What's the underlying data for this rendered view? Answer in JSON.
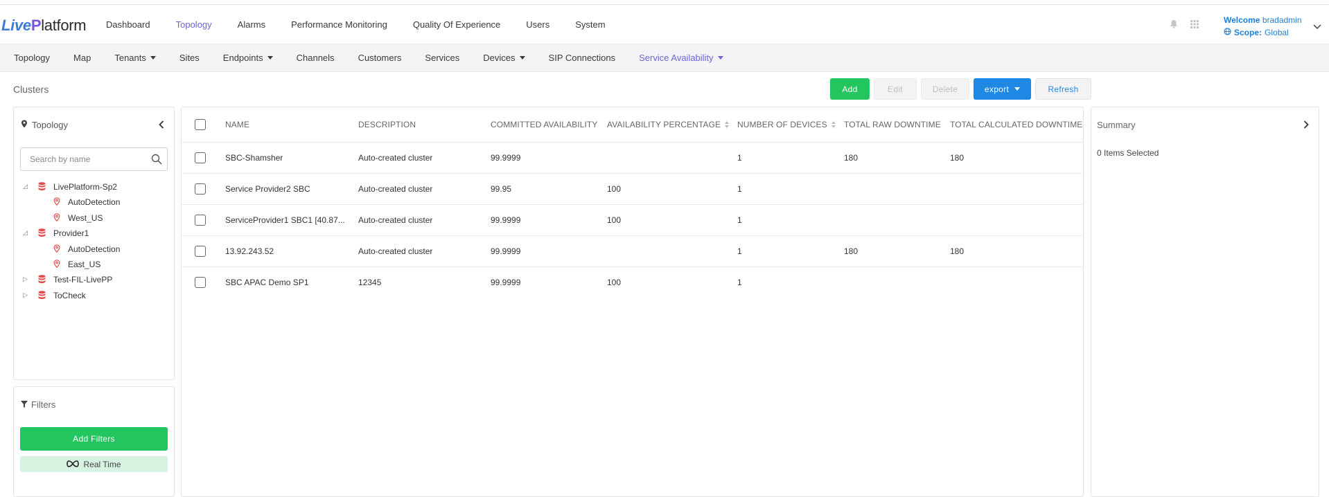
{
  "app": {
    "logo": {
      "part1": "Live",
      "part2": "P",
      "part3": "latform"
    },
    "main_menu": [
      {
        "label": "Dashboard",
        "active": false
      },
      {
        "label": "Topology",
        "active": true
      },
      {
        "label": "Alarms",
        "active": false
      },
      {
        "label": "Performance Monitoring",
        "active": false
      },
      {
        "label": "Quality Of Experience",
        "active": false
      },
      {
        "label": "Users",
        "active": false
      },
      {
        "label": "System",
        "active": false
      }
    ],
    "user": {
      "welcome_label": "Welcome",
      "username": "bradadmin",
      "scope_label": "Scope:",
      "scope_value": "Global"
    }
  },
  "sub_menu": [
    {
      "label": "Topology",
      "dropdown": false,
      "active": false
    },
    {
      "label": "Map",
      "dropdown": false,
      "active": false
    },
    {
      "label": "Tenants",
      "dropdown": true,
      "active": false
    },
    {
      "label": "Sites",
      "dropdown": false,
      "active": false
    },
    {
      "label": "Endpoints",
      "dropdown": true,
      "active": false
    },
    {
      "label": "Channels",
      "dropdown": false,
      "active": false
    },
    {
      "label": "Customers",
      "dropdown": false,
      "active": false
    },
    {
      "label": "Services",
      "dropdown": false,
      "active": false
    },
    {
      "label": "Devices",
      "dropdown": true,
      "active": false
    },
    {
      "label": "SIP Connections",
      "dropdown": false,
      "active": false
    },
    {
      "label": "Service Availability",
      "dropdown": true,
      "active": true
    }
  ],
  "page": {
    "title": "Clusters"
  },
  "toolbar": {
    "add_label": "Add",
    "edit_label": "Edit",
    "delete_label": "Delete",
    "export_label": "export",
    "refresh_label": "Refresh"
  },
  "topology_panel": {
    "title": "Topology",
    "search_placeholder": "Search by name",
    "tree": [
      {
        "label": "LivePlatform-Sp2",
        "expanded": true,
        "children": [
          "AutoDetection",
          "West_US"
        ]
      },
      {
        "label": "Provider1",
        "expanded": true,
        "children": [
          "AutoDetection",
          "East_US"
        ]
      },
      {
        "label": "Test-FIL-LivePP",
        "expanded": false,
        "children": []
      },
      {
        "label": "ToCheck",
        "expanded": false,
        "children": []
      }
    ]
  },
  "filters_panel": {
    "title": "Filters",
    "add_filters_label": "Add Filters",
    "realtime_label": "Real Time"
  },
  "table": {
    "columns": [
      "NAME",
      "DESCRIPTION",
      "COMMITTED AVAILABILITY",
      "AVAILABILITY PERCENTAGE",
      "NUMBER OF DEVICES",
      "TOTAL RAW DOWNTIME",
      "TOTAL CALCULATED DOWNTIME"
    ],
    "rows": [
      [
        "SBC-Shamsher",
        "Auto-created cluster",
        "99.9999",
        "",
        "1",
        "180",
        "180"
      ],
      [
        "Service Provider2 SBC",
        "Auto-created cluster",
        "99.95",
        "100",
        "1",
        "",
        ""
      ],
      [
        "ServiceProvider1 SBC1 [40.87...",
        "Auto-created cluster",
        "99.9999",
        "100",
        "1",
        "",
        ""
      ],
      [
        "13.92.243.52",
        "Auto-created cluster",
        "99.9999",
        "",
        "1",
        "180",
        "180"
      ],
      [
        "SBC APAC Demo SP1",
        "12345",
        "99.9999",
        "100",
        "1",
        "",
        ""
      ]
    ]
  },
  "summary_panel": {
    "title": "Summary",
    "selected_text": "0 Items Selected"
  },
  "colors": {
    "accent_purple": "#6c63d9",
    "green": "#22c55e",
    "blue": "#1e88e5",
    "tree_db_red": "#e14c4c"
  }
}
